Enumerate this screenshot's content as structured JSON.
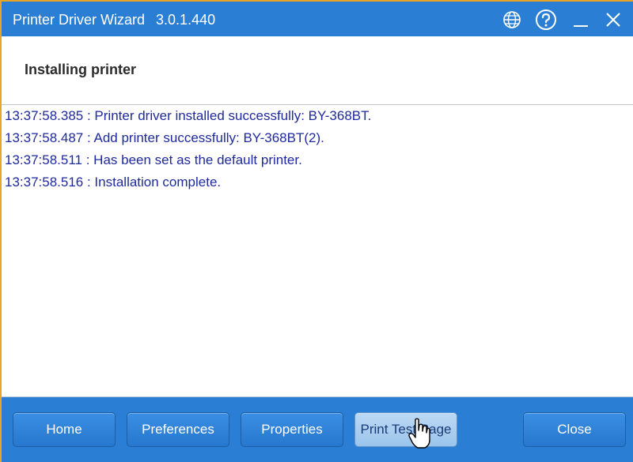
{
  "window": {
    "title": "Printer Driver Wizard",
    "version": "3.0.1.440"
  },
  "titlebar_icons": {
    "globe": "globe-icon",
    "help": "help-icon",
    "minimize": "minimize-icon",
    "close": "close-icon"
  },
  "header": {
    "title": "Installing printer"
  },
  "log": {
    "lines": [
      "13:37:58.385 : Printer driver installed successfully: BY-368BT.",
      "13:37:58.487 : Add printer successfully: BY-368BT(2).",
      "13:37:58.511 : Has been set as the default printer.",
      "13:37:58.516 : Installation complete."
    ]
  },
  "buttons": {
    "home": "Home",
    "preferences": "Preferences",
    "properties": "Properties",
    "print_test_page": "Print Test Page",
    "close": "Close"
  },
  "colors": {
    "accent": "#2a7fd4",
    "log_text": "#1f2a9c",
    "background": "#e9a52a"
  }
}
